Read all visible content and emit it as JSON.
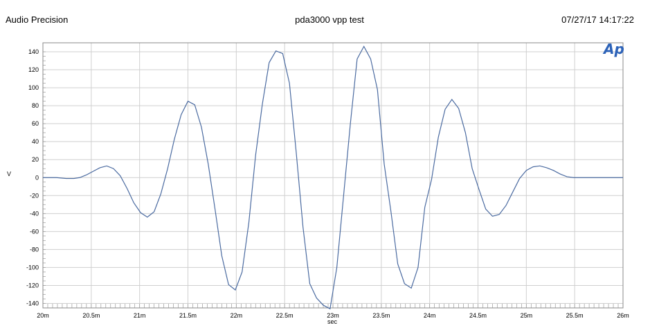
{
  "header": {
    "app_name": "Audio Precision",
    "title": "pda3000 vpp test",
    "timestamp": "07/27/17 14:17:22"
  },
  "logo_text": "Ap",
  "colors": {
    "series": "#4a6aa0",
    "grid": "#cfcfcf",
    "logo": "#2c62b8"
  },
  "chart_data": {
    "type": "line",
    "title": "pda3000 vpp test",
    "xlabel": "sec",
    "ylabel": "V",
    "xlim": [
      0.02,
      0.026
    ],
    "ylim": [
      -145,
      150
    ],
    "grid": true,
    "x_ticks": [
      {
        "v": 0.02,
        "label": "20m"
      },
      {
        "v": 0.0205,
        "label": "20.5m"
      },
      {
        "v": 0.021,
        "label": "21m"
      },
      {
        "v": 0.0215,
        "label": "21.5m"
      },
      {
        "v": 0.022,
        "label": "22m"
      },
      {
        "v": 0.0225,
        "label": "22.5m"
      },
      {
        "v": 0.023,
        "label": "23m"
      },
      {
        "v": 0.0235,
        "label": "23.5m"
      },
      {
        "v": 0.024,
        "label": "24m"
      },
      {
        "v": 0.0245,
        "label": "24.5m"
      },
      {
        "v": 0.025,
        "label": "25m"
      },
      {
        "v": 0.0255,
        "label": "25.5m"
      },
      {
        "v": 0.026,
        "label": "26m"
      }
    ],
    "y_ticks": [
      {
        "v": 140,
        "label": "140"
      },
      {
        "v": 120,
        "label": "120"
      },
      {
        "v": 100,
        "label": "100"
      },
      {
        "v": 80,
        "label": "80"
      },
      {
        "v": 60,
        "label": "60"
      },
      {
        "v": 40,
        "label": "40"
      },
      {
        "v": 20,
        "label": "20"
      },
      {
        "v": 0,
        "label": "0"
      },
      {
        "v": -20,
        "label": "-20"
      },
      {
        "v": -40,
        "label": "-40"
      },
      {
        "v": -60,
        "label": "-60"
      },
      {
        "v": -80,
        "label": "-80"
      },
      {
        "v": -100,
        "label": "-100"
      },
      {
        "v": -120,
        "label": "-120"
      },
      {
        "v": -140,
        "label": "-140"
      }
    ],
    "series": [
      {
        "x": [
          0.02,
          0.02014,
          0.02024,
          0.02032,
          0.02038,
          0.02045,
          0.02052,
          0.02059,
          0.02066,
          0.02073,
          0.0208,
          0.02087,
          0.02094,
          0.02101,
          0.02108,
          0.02115,
          0.02122,
          0.02129,
          0.02136,
          0.02143,
          0.0215,
          0.02157,
          0.02164,
          0.02171,
          0.02178,
          0.02185,
          0.02192,
          0.02199,
          0.02206,
          0.02213,
          0.0222,
          0.02227,
          0.02234,
          0.02241,
          0.02248,
          0.02255,
          0.02262,
          0.02269,
          0.02276,
          0.02283,
          0.0229,
          0.02297,
          0.02304,
          0.02311,
          0.02318,
          0.02325,
          0.02332,
          0.02339,
          0.02346,
          0.02353,
          0.0236,
          0.02367,
          0.02374,
          0.02381,
          0.02388,
          0.02395,
          0.02402,
          0.02409,
          0.02416,
          0.02423,
          0.0243,
          0.02437,
          0.02444,
          0.02451,
          0.02458,
          0.02465,
          0.02472,
          0.02479,
          0.02486,
          0.02493,
          0.025,
          0.02507,
          0.02514,
          0.02521,
          0.02528,
          0.02535,
          0.02542,
          0.02549,
          0.02556,
          0.02563,
          0.0257,
          0.02577,
          0.02584,
          0.02592,
          0.026
        ],
        "y": [
          0,
          0,
          -1,
          -1,
          0,
          3,
          7,
          11,
          13,
          10,
          2,
          -12,
          -28,
          -39,
          -44,
          -38,
          -18,
          10,
          43,
          70,
          85,
          81,
          56,
          15,
          -35,
          -87,
          -119,
          -125,
          -105,
          -50,
          25,
          82,
          128,
          141,
          138,
          105,
          28,
          -55,
          -118,
          -134,
          -142,
          -146,
          -100,
          -20,
          60,
          132,
          146,
          132,
          98,
          15,
          -38,
          -96,
          -118,
          -123,
          -100,
          -33,
          -2,
          45,
          76,
          87,
          77,
          50,
          10,
          -13,
          -35,
          -43,
          -41,
          -31,
          -16,
          -1,
          8,
          12,
          13,
          11,
          8,
          4,
          1,
          0,
          0,
          0,
          0,
          0,
          0,
          0,
          0
        ]
      }
    ]
  }
}
